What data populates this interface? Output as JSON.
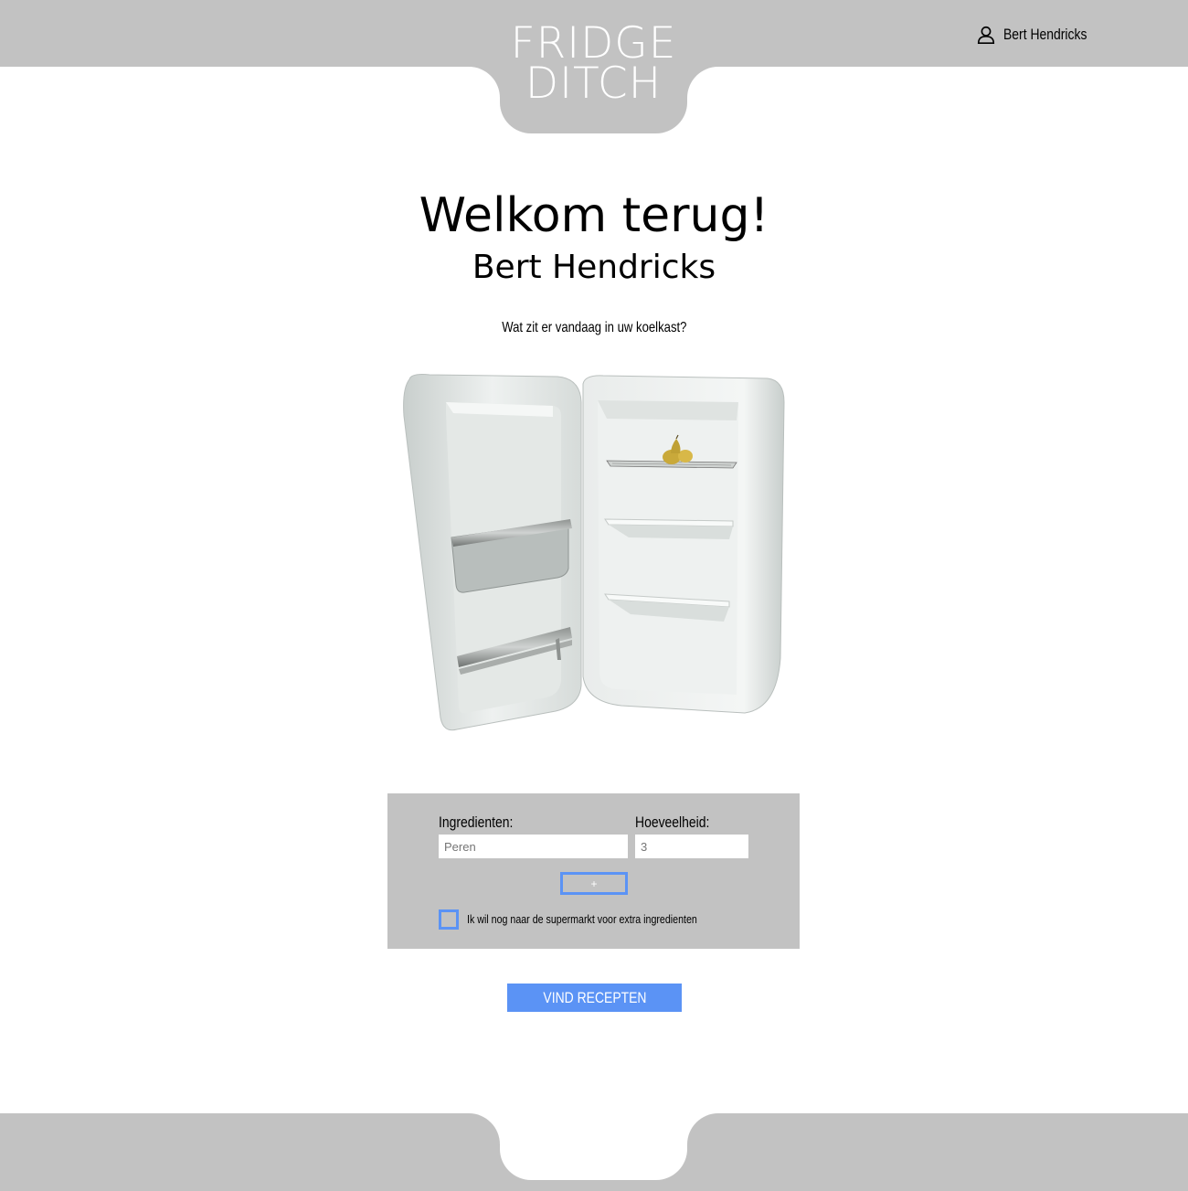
{
  "header": {
    "logo_line1": "FRIDGE",
    "logo_line2": "DITCH",
    "user_name": "Bert Hendricks",
    "user_icon": "user-icon"
  },
  "main": {
    "welcome": "Welkom terug!",
    "user_name": "Bert Hendricks",
    "question": "Wat zit er vandaag in uw koelkast?",
    "fridge_image": "open-fridge-illustration"
  },
  "form": {
    "ingredients_label": "Ingredienten:",
    "quantity_label": "Hoeveelheid:",
    "ingredients_placeholder": "Peren",
    "quantity_placeholder": "3",
    "add_label": "+",
    "checkbox_label": "Ik wil nog naar de supermarkt voor extra ingredienten",
    "submit_label": "VIND RECEPTEN"
  },
  "colors": {
    "bar_gray": "#c2c2c2",
    "accent_blue": "#5b93f5"
  }
}
